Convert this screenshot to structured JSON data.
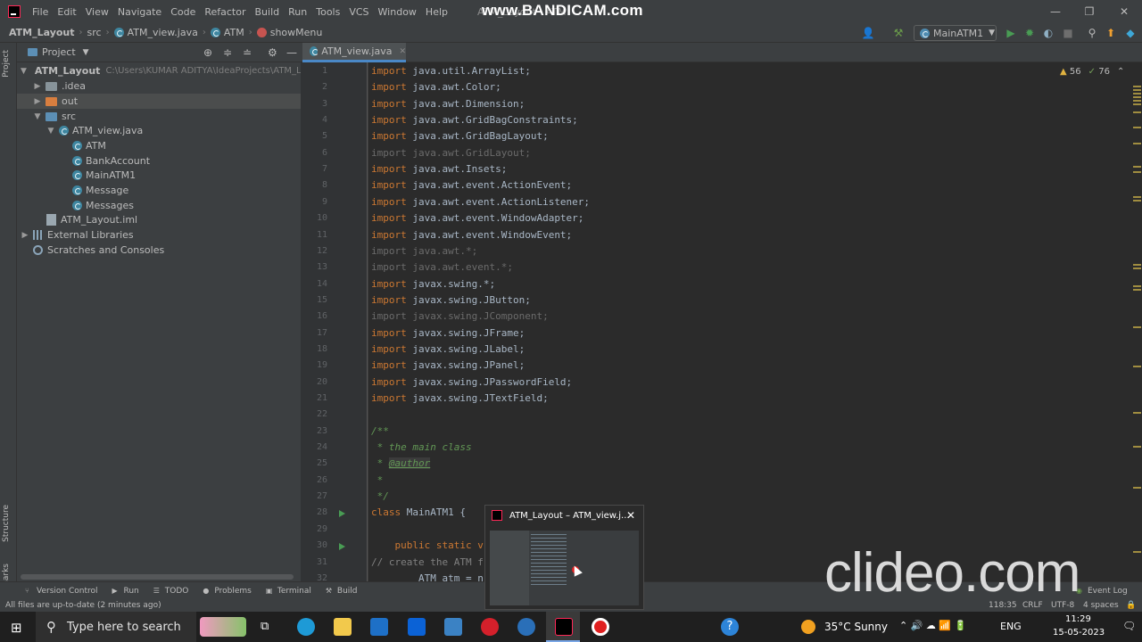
{
  "window": {
    "title": "ATM_Layout - ATM",
    "menu": [
      "File",
      "Edit",
      "View",
      "Navigate",
      "Code",
      "Refactor",
      "Build",
      "Run",
      "Tools",
      "VCS",
      "Window",
      "Help"
    ]
  },
  "watermarks": {
    "bandicam": "www.BANDICAM.com",
    "clideo": "clideo.com"
  },
  "breadcrumb": [
    "ATM_Layout",
    "src",
    "ATM_view.java",
    "ATM",
    "showMenu"
  ],
  "run_config": "MainATM1",
  "left_strip": {
    "project": "Project",
    "structure": "Structure",
    "bookmarks": "Bookmarks"
  },
  "project_panel": {
    "title": "Project",
    "root": {
      "name": "ATM_Layout",
      "path": "C:\\Users\\KUMAR ADITYA\\IdeaProjects\\ATM_Layout"
    },
    "items": [
      {
        "label": ".idea",
        "kind": "folder"
      },
      {
        "label": "out",
        "kind": "folder-orange"
      },
      {
        "label": "src",
        "kind": "folder-blue"
      },
      {
        "label": "ATM_view.java",
        "kind": "class"
      },
      {
        "label": "ATM",
        "kind": "class"
      },
      {
        "label": "BankAccount",
        "kind": "class"
      },
      {
        "label": "MainATM1",
        "kind": "class"
      },
      {
        "label": "Message",
        "kind": "class"
      },
      {
        "label": "Messages",
        "kind": "class"
      },
      {
        "label": "ATM_Layout.iml",
        "kind": "file"
      },
      {
        "label": "External Libraries",
        "kind": "lib"
      },
      {
        "label": "Scratches and Consoles",
        "kind": "scratch"
      }
    ]
  },
  "editor": {
    "tab": "ATM_view.java",
    "warnings": "56",
    "checks": "76",
    "lines": [
      {
        "n": "1",
        "kw": "import",
        "rest": " java.util.ArrayList;",
        "style": "normal"
      },
      {
        "n": "2",
        "kw": "import",
        "rest": " java.awt.Color;",
        "style": "normal"
      },
      {
        "n": "3",
        "kw": "import",
        "rest": " java.awt.Dimension;",
        "style": "normal"
      },
      {
        "n": "4",
        "kw": "import",
        "rest": " java.awt.GridBagConstraints;",
        "style": "normal"
      },
      {
        "n": "5",
        "kw": "import",
        "rest": " java.awt.GridBagLayout;",
        "style": "normal"
      },
      {
        "n": "6",
        "kw": "import",
        "rest": " java.awt.GridLayout;",
        "style": "dim"
      },
      {
        "n": "7",
        "kw": "import",
        "rest": " java.awt.Insets;",
        "style": "normal"
      },
      {
        "n": "8",
        "kw": "import",
        "rest": " java.awt.event.ActionEvent;",
        "style": "normal"
      },
      {
        "n": "9",
        "kw": "import",
        "rest": " java.awt.event.ActionListener;",
        "style": "normal"
      },
      {
        "n": "10",
        "kw": "import",
        "rest": " java.awt.event.WindowAdapter;",
        "style": "normal"
      },
      {
        "n": "11",
        "kw": "import",
        "rest": " java.awt.event.WindowEvent;",
        "style": "normal"
      },
      {
        "n": "12",
        "kw": "import",
        "rest": " java.awt.*;",
        "style": "dim"
      },
      {
        "n": "13",
        "kw": "import",
        "rest": " java.awt.event.*;",
        "style": "dim"
      },
      {
        "n": "14",
        "kw": "import",
        "rest": " javax.swing.*;",
        "style": "normal"
      },
      {
        "n": "15",
        "kw": "import",
        "rest": " javax.swing.JButton;",
        "style": "normal"
      },
      {
        "n": "16",
        "kw": "import",
        "rest": " javax.swing.JComponent;",
        "style": "dim"
      },
      {
        "n": "17",
        "kw": "import",
        "rest": " javax.swing.JFrame;",
        "style": "normal"
      },
      {
        "n": "18",
        "kw": "import",
        "rest": " javax.swing.JLabel;",
        "style": "normal"
      },
      {
        "n": "19",
        "kw": "import",
        "rest": " javax.swing.JPanel;",
        "style": "normal"
      },
      {
        "n": "20",
        "kw": "import",
        "rest": " javax.swing.JPasswordField;",
        "style": "normal"
      },
      {
        "n": "21",
        "kw": "import",
        "rest": " javax.swing.JTextField;",
        "style": "normal"
      },
      {
        "n": "22",
        "kw": "",
        "rest": "",
        "style": "normal"
      },
      {
        "n": "23",
        "kw": "",
        "rest": "/**",
        "style": "comment"
      },
      {
        "n": "24",
        "kw": "",
        "rest": " * the main class",
        "style": "comment"
      },
      {
        "n": "25",
        "kw": "",
        "rest": " * ",
        "tag": "@author",
        "style": "comment"
      },
      {
        "n": "26",
        "kw": "",
        "rest": " *",
        "style": "comment"
      },
      {
        "n": "27",
        "kw": "",
        "rest": " */",
        "style": "comment"
      },
      {
        "n": "28",
        "kw": "class",
        "rest": " MainATM1 {",
        "style": "normal"
      },
      {
        "n": "29",
        "kw": "",
        "rest": "",
        "style": "normal"
      },
      {
        "n": "30",
        "kw": "    public static v",
        "rest": "",
        "style": "normal"
      },
      {
        "n": "31",
        "kw": "",
        "rest": "// create the ATM f",
        "style": "gray"
      },
      {
        "n": "32",
        "kw": "",
        "rest": "        ATM atm = n",
        "style": "normal"
      }
    ]
  },
  "bottom_tools": [
    "Version Control",
    "Run",
    "TODO",
    "Problems",
    "Terminal",
    "Build"
  ],
  "event_log": "Event Log",
  "status": {
    "left": "All files are up-to-date (2 minutes ago)",
    "pos": "118:35",
    "eol": "CRLF",
    "enc": "UTF-8",
    "indent": "4 spaces"
  },
  "thumbnail": {
    "title": "ATM_Layout – ATM_view.j..."
  },
  "taskbar": {
    "search": "Type here to search",
    "weather": "35°C  Sunny",
    "lang": "ENG",
    "time": "11:29",
    "date": "15-05-2023"
  }
}
